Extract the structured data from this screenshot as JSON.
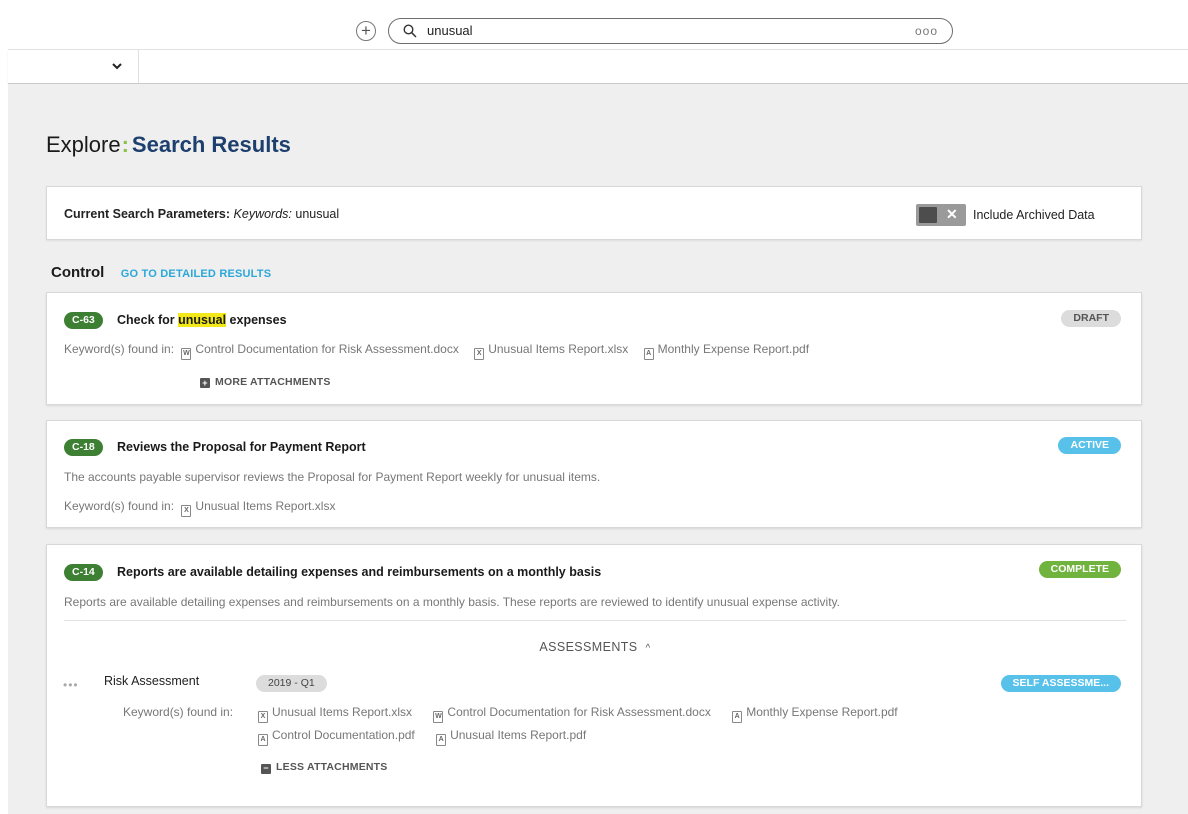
{
  "header": {
    "search_value": "unusual",
    "search_menu_glyph": "ooo"
  },
  "page": {
    "title_prefix": "Explore",
    "title_colon": ":",
    "title_main": "Search Results"
  },
  "params": {
    "label": "Current Search Parameters:",
    "keywords_label": "Keywords:",
    "keywords_value": "unusual",
    "toggle_label": "Include Archived Data",
    "toggle_on": false
  },
  "section": {
    "title": "Control",
    "link": "GO TO DETAILED RESULTS"
  },
  "cards": [
    {
      "id": "C-63",
      "title_before": "Check for ",
      "title_highlight": "unusual",
      "title_after": " expenses",
      "status": "DRAFT",
      "keyword_label": "Keyword(s) found in:",
      "files": [
        {
          "name": "Control Documentation for Risk Assessment.docx",
          "type": "docx"
        },
        {
          "name": "Unusual Items Report.xlsx",
          "type": "xlsx"
        },
        {
          "name": "Monthly Expense Report.pdf",
          "type": "pdf"
        }
      ],
      "more_label": "MORE ATTACHMENTS"
    },
    {
      "id": "C-18",
      "title": "Reviews the Proposal for Payment Report",
      "status": "ACTIVE",
      "description": "The accounts payable supervisor reviews the Proposal for Payment Report weekly for unusual items.",
      "keyword_label": "Keyword(s) found in:",
      "files": [
        {
          "name": "Unusual Items Report.xlsx",
          "type": "xlsx"
        }
      ]
    },
    {
      "id": "C-14",
      "title": "Reports are available detailing expenses and reimbursements on a monthly basis",
      "status": "COMPLETE",
      "description": "Reports are available detailing expenses and reimbursements on a monthly basis. These reports are reviewed to identify unusual expense activity.",
      "assessments_label": "ASSESSMENTS",
      "assessment": {
        "dots": "•••",
        "name": "Risk Assessment",
        "period": "2019 - Q1",
        "status": "SELF ASSESSME...",
        "keyword_label": "Keyword(s) found in:",
        "files_row1": [
          {
            "name": "Unusual Items Report.xlsx",
            "type": "xlsx"
          },
          {
            "name": "Control Documentation for Risk Assessment.docx",
            "type": "docx"
          },
          {
            "name": "Monthly Expense Report.pdf",
            "type": "pdf"
          }
        ],
        "files_row2": [
          {
            "name": "Control Documentation.pdf",
            "type": "pdf"
          },
          {
            "name": "Unusual Items Report.pdf",
            "type": "pdf"
          }
        ],
        "less_label": "LESS ATTACHMENTS"
      }
    }
  ],
  "icons": {
    "add": "plus-circle-icon",
    "search": "magnifier-icon",
    "chevron": "chevron-down-icon",
    "docx": "word-file-icon",
    "xlsx": "excel-file-icon",
    "pdf": "pdf-file-icon"
  },
  "colors": {
    "accent_blue": "#1d3f6e",
    "link_blue": "#2ca7d9",
    "id_green": "#3d7f33",
    "complete_green": "#70b33e",
    "active_blue": "#58c1ea",
    "highlight": "#f3e91a",
    "colon_green": "#8bc34a"
  }
}
